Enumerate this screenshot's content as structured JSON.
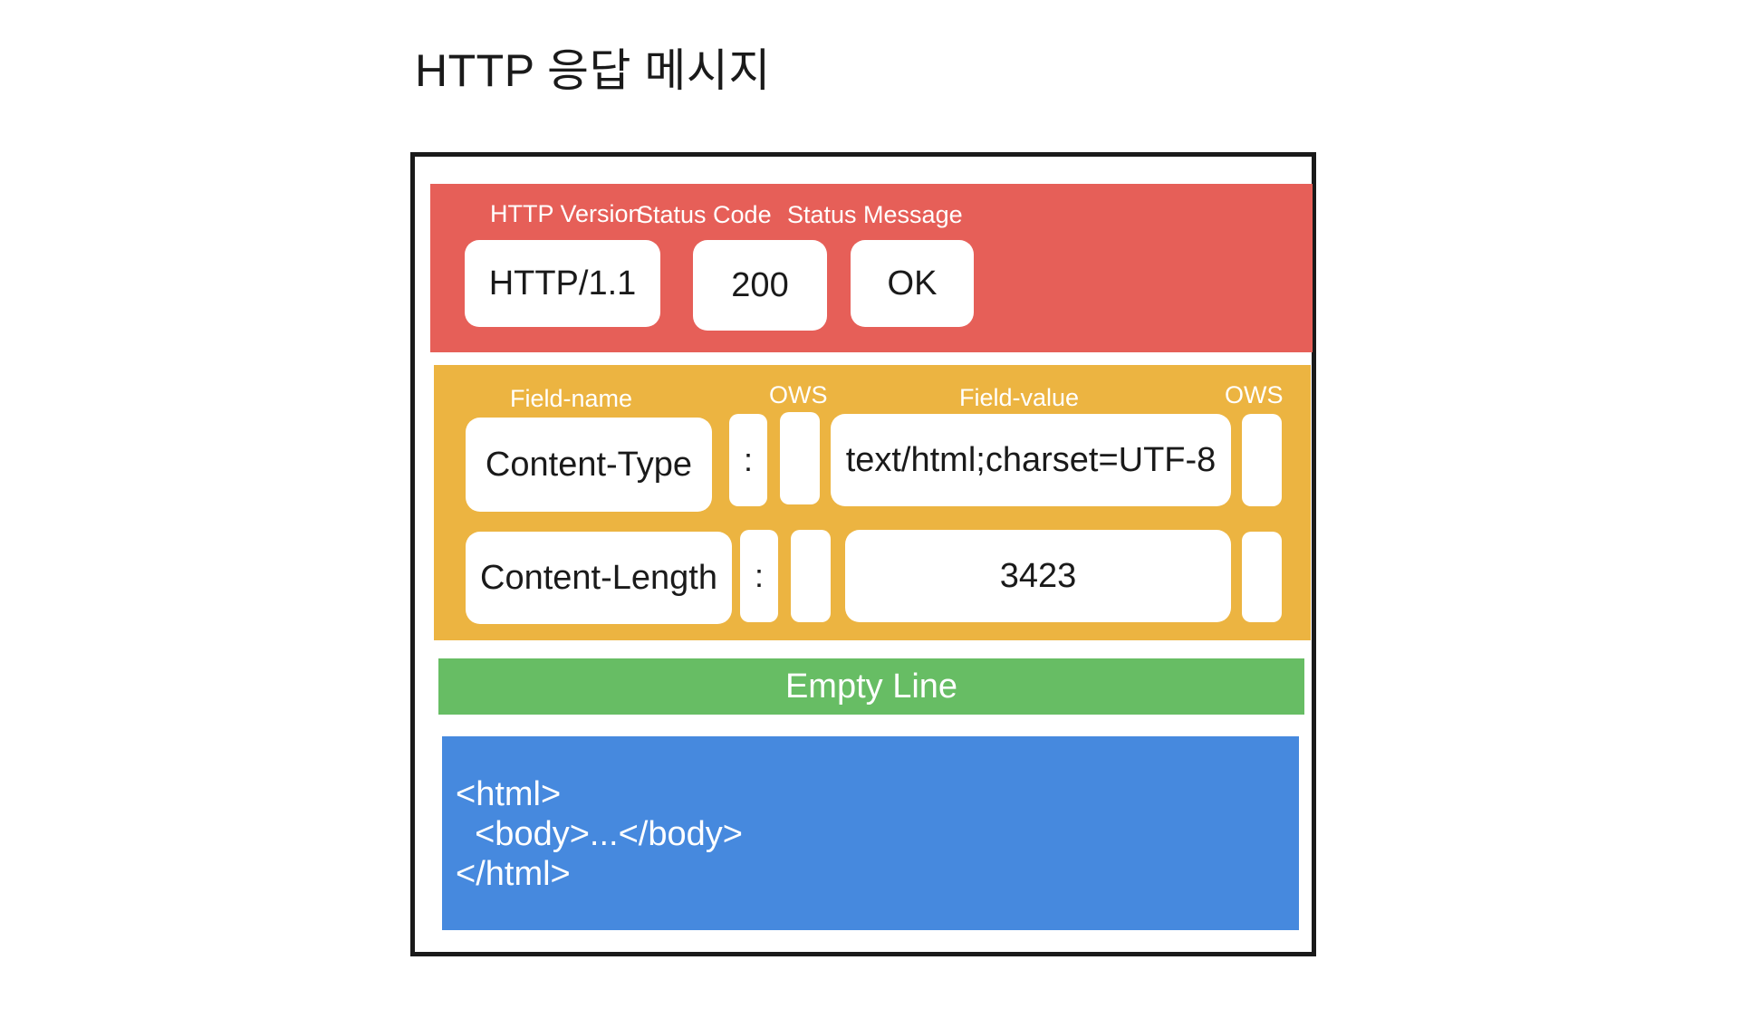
{
  "title": "HTTP 응답 메시지",
  "status_line": {
    "labels": {
      "version": "HTTP Version",
      "code": "Status Code",
      "message": "Status Message"
    },
    "values": {
      "version": "HTTP/1.1",
      "code": "200",
      "message": "OK"
    }
  },
  "headers": {
    "labels": {
      "field_name": "Field-name",
      "ows_left": "OWS",
      "field_value": "Field-value",
      "ows_right": "OWS"
    },
    "rows": [
      {
        "name": "Content-Type",
        "colon": ":",
        "value": "text/html;charset=UTF-8"
      },
      {
        "name": "Content-Length",
        "colon": ":",
        "value": "3423"
      }
    ]
  },
  "empty_line": "Empty Line",
  "body_lines": [
    "<html>",
    "  <body>...</body>",
    "</html>"
  ],
  "colors": {
    "status_line": "#e65f58",
    "headers": "#ecb441",
    "empty_line": "#67bd64",
    "body": "#4689de"
  }
}
